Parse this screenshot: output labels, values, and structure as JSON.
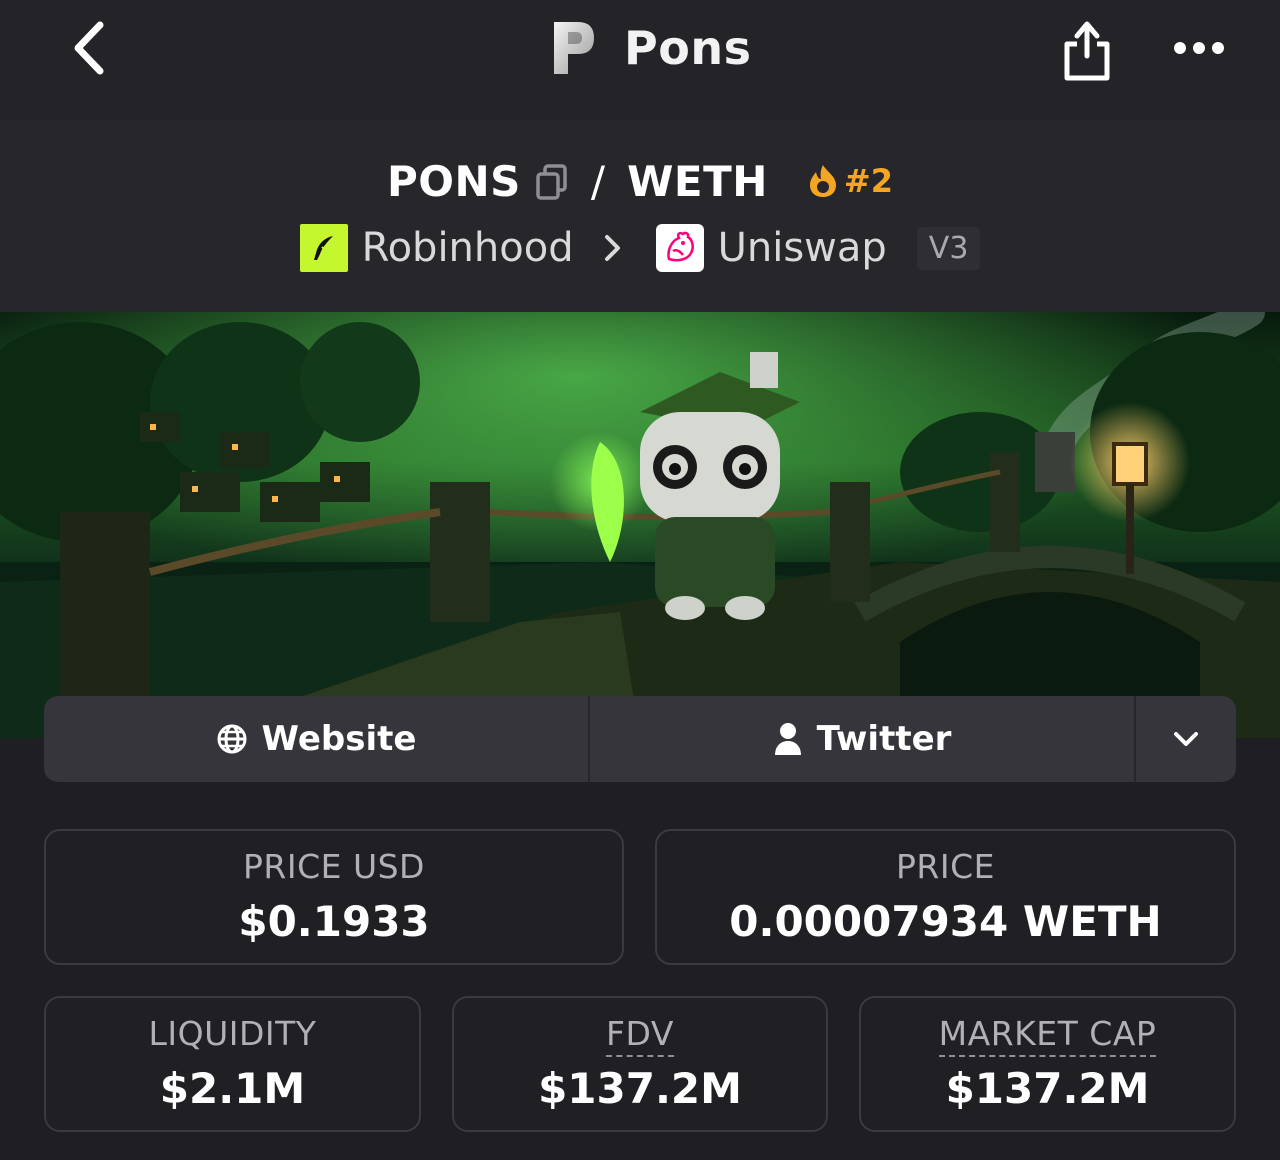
{
  "nav": {
    "title": "Pons",
    "back_icon": "chevron-left-icon",
    "share_icon": "share-icon",
    "more_icon": "more-horizontal-icon"
  },
  "pair": {
    "base": "PONS",
    "separator": "/",
    "quote": "WETH",
    "rank": "#2",
    "rank_color": "#f5a524",
    "chain": "Robinhood",
    "chain_color": "#c5f72f",
    "dex": "Uniswap",
    "dex_color": "#ff007a",
    "version": "V3"
  },
  "links": {
    "website": "Website",
    "twitter": "Twitter"
  },
  "stats": {
    "price_usd": {
      "label": "PRICE USD",
      "value": "$0.1933"
    },
    "price": {
      "label": "PRICE",
      "value": "0.00007934 WETH"
    },
    "liquidity": {
      "label": "LIQUIDITY",
      "value": "$2.1M"
    },
    "fdv": {
      "label": "FDV",
      "value": "$137.2M"
    },
    "market_cap": {
      "label": "MARKET CAP",
      "value": "$137.2M"
    }
  }
}
